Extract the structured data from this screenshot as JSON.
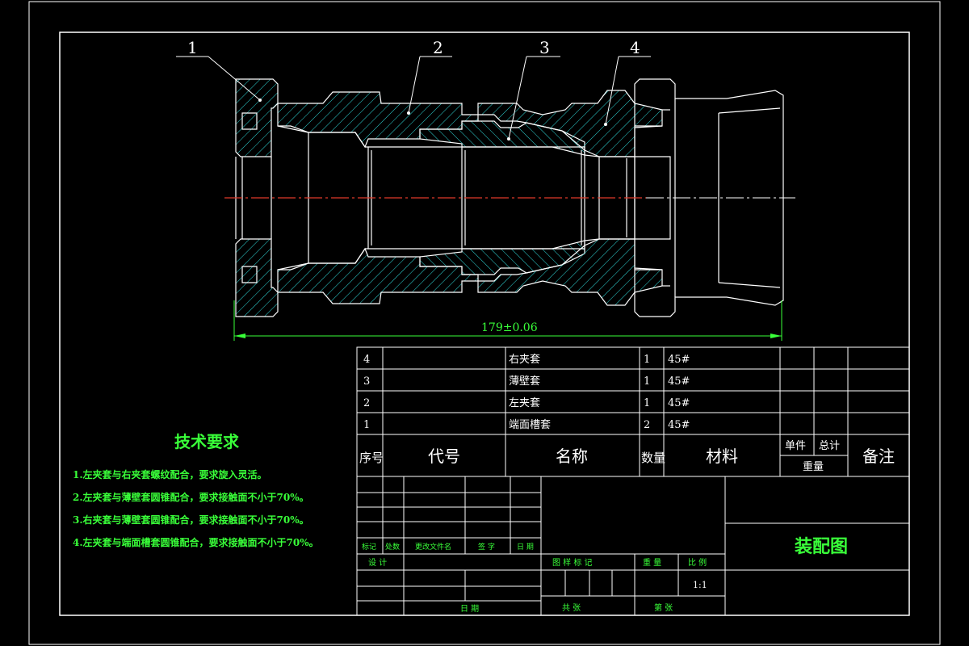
{
  "balloons": [
    "1",
    "2",
    "3",
    "4"
  ],
  "dimension": "179±0.06",
  "bom": {
    "rows": [
      {
        "no": "4",
        "code": "",
        "name": "右夹套",
        "qty": "1",
        "material": "45#"
      },
      {
        "no": "3",
        "code": "",
        "name": "薄壁套",
        "qty": "1",
        "material": "45#"
      },
      {
        "no": "2",
        "code": "",
        "name": "左夹套",
        "qty": "1",
        "material": "45#"
      },
      {
        "no": "1",
        "code": "",
        "name": "端面槽套",
        "qty": "2",
        "material": "45#"
      }
    ],
    "header": {
      "no": "序号",
      "code": "代号",
      "name": "名称",
      "qty": "数量",
      "material": "材料",
      "single": "单件",
      "total": "总计",
      "weight": "重量",
      "remark": "备注"
    }
  },
  "tech": {
    "title": "技术要求",
    "items": [
      "1.左夹套与右夹套螺纹配合，要求旋入灵活。",
      "2.左夹套与薄壁套圆锥配合，要求接触面不小于70%。",
      "3.右夹套与薄壁套圆锥配合，要求接触面不小于70%。",
      "4.左夹套与端面槽套圆锥配合，要求接触面不小于70%。"
    ]
  },
  "title_block": {
    "drawing_name": "装配图",
    "rev_labels": [
      "标记",
      "处数",
      "更改文件名",
      "签 字",
      "日 期"
    ],
    "design": "设 计",
    "date": "日 期",
    "stage": "图 样 标 记",
    "weight": "重 量",
    "scale_label": "比 例",
    "scale_value": "1:1",
    "sheets": "共     张",
    "sheet_no": "第     张"
  }
}
